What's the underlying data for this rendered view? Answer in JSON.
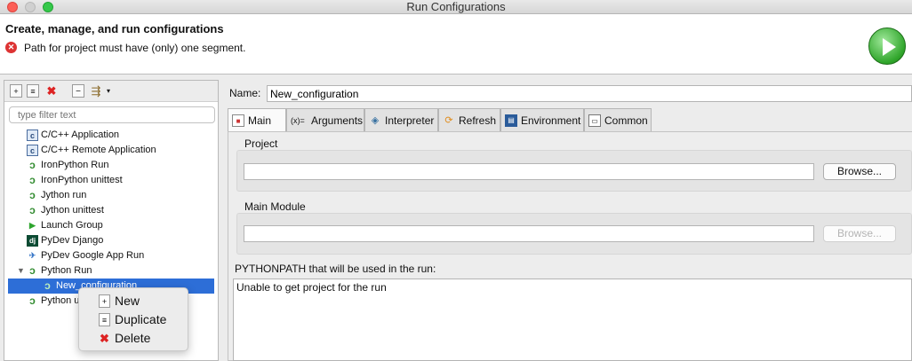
{
  "window": {
    "title": "Run Configurations"
  },
  "header": {
    "title": "Create, manage, and run configurations",
    "error_message": "Path for project must have (only) one segment."
  },
  "filter": {
    "placeholder": "type filter text"
  },
  "tree": {
    "items": [
      {
        "label": "C/C++ Application",
        "icon": "c-app-icon"
      },
      {
        "label": "C/C++ Remote Application",
        "icon": "c-remote-icon"
      },
      {
        "label": "IronPython Run",
        "icon": "python-icon"
      },
      {
        "label": "IronPython unittest",
        "icon": "python-unittest-icon"
      },
      {
        "label": "Jython run",
        "icon": "python-icon"
      },
      {
        "label": "Jython unittest",
        "icon": "python-unittest-icon"
      },
      {
        "label": "Launch Group",
        "icon": "launch-group-icon"
      },
      {
        "label": "PyDev Django",
        "icon": "django-icon"
      },
      {
        "label": "PyDev Google App Run",
        "icon": "google-app-icon"
      },
      {
        "label": "Python Run",
        "icon": "python-icon",
        "expanded": true
      },
      {
        "label": "New_configuration",
        "icon": "python-icon",
        "selected": true
      },
      {
        "label": "Python u",
        "icon": "python-unittest-icon"
      }
    ]
  },
  "context_menu": {
    "items": [
      {
        "label": "New",
        "icon": "new-doc-icon"
      },
      {
        "label": "Duplicate",
        "icon": "duplicate-icon"
      },
      {
        "label": "Delete",
        "icon": "delete-icon"
      }
    ]
  },
  "config": {
    "name_label": "Name:",
    "name_value": "New_configuration",
    "tabs": [
      {
        "label": "Main",
        "active": true
      },
      {
        "label": "Arguments"
      },
      {
        "label": "Interpreter"
      },
      {
        "label": "Refresh"
      },
      {
        "label": "Environment"
      },
      {
        "label": "Common"
      }
    ],
    "project_label": "Project",
    "project_value": "",
    "browse_label": "Browse...",
    "main_module_label": "Main Module",
    "main_module_value": "",
    "pythonpath_label": "PYTHONPATH that will be used in the run:",
    "pythonpath_text": "Unable to get project for the run"
  },
  "colors": {
    "selection": "#2d6ed7",
    "error": "#dd3333",
    "run": "#2fa52a"
  }
}
